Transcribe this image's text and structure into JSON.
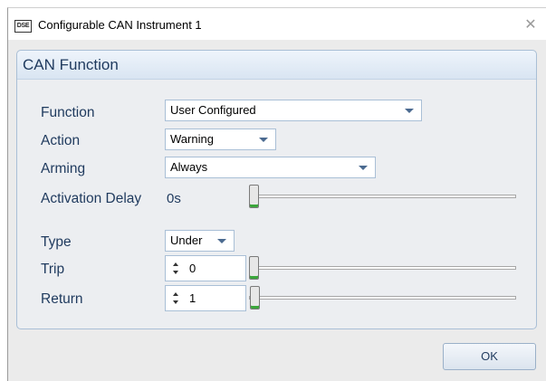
{
  "window": {
    "app_icon_text": "DSE",
    "title": "Configurable CAN Instrument 1",
    "close_glyph": "✕"
  },
  "group": {
    "title": "CAN Function"
  },
  "fields": {
    "function_label": "Function",
    "function_value": "User Configured",
    "action_label": "Action",
    "action_value": "Warning",
    "arming_label": "Arming",
    "arming_value": "Always",
    "activation_delay_label": "Activation Delay",
    "activation_delay_value": "0s",
    "activation_delay_level": 0,
    "type_label": "Type",
    "type_value": "Under",
    "trip_label": "Trip",
    "trip_value": "0",
    "trip_level": 0,
    "return_label": "Return",
    "return_value": "1",
    "return_level": 0.005
  },
  "buttons": {
    "ok_label": "OK"
  },
  "colors": {
    "label_text": "#1f3a5e",
    "group_border": "#a9bfd6",
    "slider_thumb_accent": "#3aa63a"
  }
}
